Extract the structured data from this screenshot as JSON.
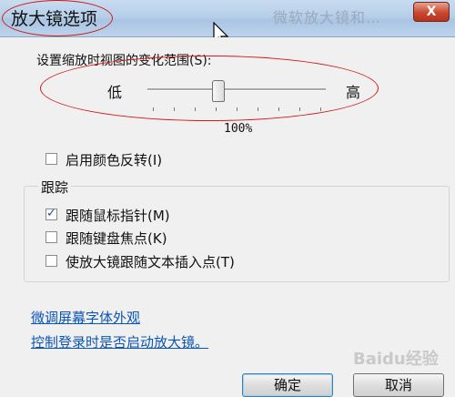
{
  "window": {
    "title": "放大镜选项",
    "ghost_title": "微软放大镜和…",
    "close_label": "X"
  },
  "zoom": {
    "label": "设置缩放时视图的变化范围(S):",
    "low": "低",
    "high": "高",
    "percent_label": "100%",
    "slider_value_fraction": 0.4
  },
  "invert": {
    "label": "启用颜色反转(I)",
    "checked": false
  },
  "tracking": {
    "title": "跟踪",
    "items": [
      {
        "label": "跟随鼠标指针(M)",
        "checked": true
      },
      {
        "label": "跟随键盘焦点(K)",
        "checked": false
      },
      {
        "label": "使放大镜跟随文本插入点(T)",
        "checked": false
      }
    ]
  },
  "links": {
    "fonts": "微调屏幕字体外观",
    "logon": "控制登录时是否启动放大镜。"
  },
  "buttons": {
    "ok": "确定",
    "cancel": "取消"
  },
  "watermark": "Baidu经验",
  "colors": {
    "annotation": "#d11a1a",
    "link": "#0b55b6"
  }
}
